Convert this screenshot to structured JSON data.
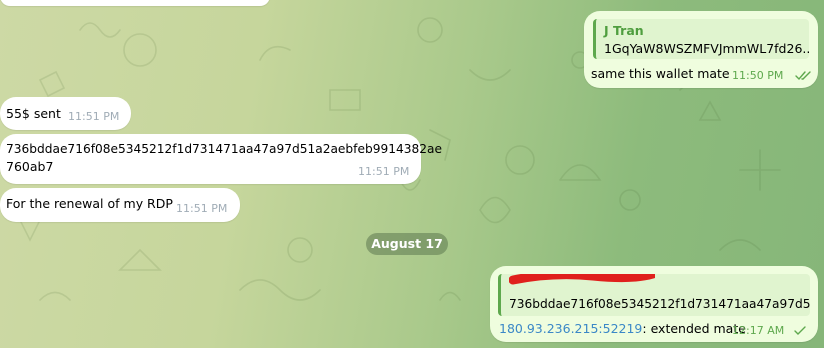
{
  "messages": {
    "out_top": {
      "reply_name": "J Tran",
      "reply_text": "1GqYaW8WSZMFVJmmWL7fd26...",
      "text": "same this wallet mate",
      "time": "11:50 PM"
    },
    "in_1": {
      "text": "55$ sent",
      "time": "11:51 PM"
    },
    "in_2": {
      "line1": "736bddae716f08e5345212f1d731471aa47a97d51a2aebfeb9914382ae",
      "line2": "760ab7",
      "time": "11:51 PM"
    },
    "in_3": {
      "text": "For the renewal of my RDP",
      "time": "11:51 PM"
    },
    "date_separator": "August 17",
    "out_bottom": {
      "reply_text": "736bddae716f08e5345212f1d731471aa47a97d5...",
      "link": "180.93.236.215:52219",
      "text_suffix": ": extended mate",
      "time": "12:17 AM"
    }
  },
  "colors": {
    "outgoing_bubble": "#effdde",
    "incoming_bubble": "#ffffff",
    "accent_green": "#5ea84d",
    "link_blue": "#3b88c7",
    "redaction_red": "#e0201c"
  }
}
